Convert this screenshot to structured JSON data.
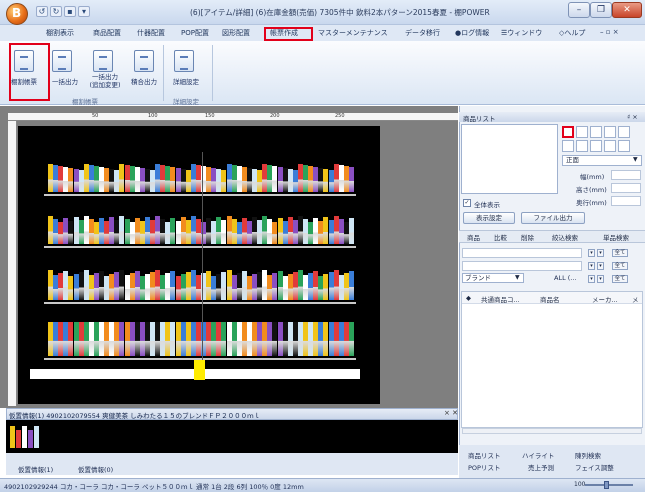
{
  "window": {
    "title": "(6)[アイテム/詳細] (6)在庫金額(売価) 7305件中 飲料2本パターン2015春夏 - 棚POWER",
    "app_icon_glyph": "B",
    "qat": [
      "↺",
      "↻",
      "▪",
      "▾"
    ],
    "minimize": "–",
    "restore": "❐",
    "close": "✕"
  },
  "ribbon_tabs": [
    "棚割表示",
    "商品配置",
    "什器配置",
    "POP配置",
    "図形配置",
    "帳票作成",
    "マスターメンテナンス",
    "データ移行",
    "●ログ情報",
    "☰ウィンドウ",
    "◇ヘルプ",
    "– ▫ ×"
  ],
  "ribbon_buttons": {
    "shelf_report": "棚割帳票",
    "batch_output": "一括出力",
    "batch_output_append": "一括出力\n(追加変更)",
    "calc_output": "積合出力",
    "detail_settings": "詳細設定"
  },
  "ribbon_groups": {
    "shelf_report": "棚割帳票",
    "detail_settings": "詳細設定"
  },
  "ruler": [
    "50",
    "100",
    "150",
    "200",
    "250"
  ],
  "info_panel": {
    "text": "仮置情報(1) 4902102079554 爽健美茶 しみわたる１５のブレンドＦＰ２０００ｍｌ",
    "close": "× ✕",
    "tab1": "仮置情報(1)",
    "tab2": "仮置情報(0)"
  },
  "right_panel": {
    "title": "商品リスト",
    "pin": "♯ ×",
    "front_select": "正面",
    "width_label": "幅(mm)",
    "height_label": "高さ(mm)",
    "depth_label": "奥行(mm)",
    "show_all": "全体表示",
    "display_settings_button": "表示設定",
    "file_output_button": "ファイル出力",
    "search_tabs": [
      "商品",
      "比較",
      "削除",
      "絞込検索",
      "単品検索"
    ],
    "all_label": "全て",
    "brand_select": "ブランド",
    "all_select": "ALL (...",
    "list_headers": [
      "◆",
      "共通商品コ...",
      "商品名",
      "メーカ...",
      "メ"
    ],
    "bottom_tabs": {
      "product_list": "商品リスト",
      "highlight": "ハイライト",
      "shelf_search": "陳列検索",
      "pop_list": "POPリスト",
      "sales_forecast": "売上予測",
      "face_adjust": "フェイス調整"
    }
  },
  "statusbar": {
    "text": "4902102929244 コカ・コーラ コカ・コーラ ペット５００ｍｌ 通常 1台 2段 6列 100％ 0度 12mm",
    "zoom": "100"
  },
  "colors": {
    "highlight_red": "#e2001a",
    "product_palette": [
      "#f0c419",
      "#3a7dd8",
      "#e13b3b",
      "#2aa35a",
      "#ffffff",
      "#f28c1e",
      "#8a4fc2",
      "#111111",
      "#cfe6f5"
    ]
  }
}
